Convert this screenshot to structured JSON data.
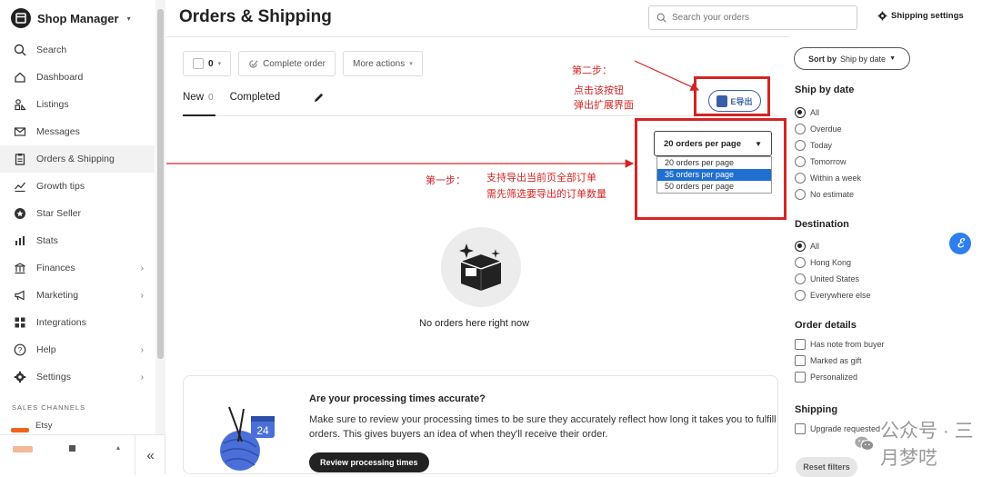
{
  "sidebar": {
    "title": "Shop Manager",
    "items": [
      {
        "label": "Search",
        "icon": "search-icon"
      },
      {
        "label": "Dashboard",
        "icon": "home-icon"
      },
      {
        "label": "Listings",
        "icon": "listings-icon"
      },
      {
        "label": "Messages",
        "icon": "mail-icon"
      },
      {
        "label": "Orders & Shipping",
        "icon": "clipboard-icon"
      },
      {
        "label": "Growth tips",
        "icon": "chart-icon"
      },
      {
        "label": "Star Seller",
        "icon": "star-seller-icon"
      },
      {
        "label": "Stats",
        "icon": "stats-icon"
      },
      {
        "label": "Finances",
        "icon": "bank-icon"
      },
      {
        "label": "Marketing",
        "icon": "megaphone-icon"
      },
      {
        "label": "Integrations",
        "icon": "grid-icon"
      },
      {
        "label": "Help",
        "icon": "help-icon"
      },
      {
        "label": "Settings",
        "icon": "gear-icon"
      }
    ],
    "sales_channels_label": "SALES CHANNELS",
    "etsy_label": "Etsy",
    "collapse_glyph": "«"
  },
  "header": {
    "title": "Orders & Shipping",
    "search_placeholder": "Search your orders",
    "shipping_settings": "Shipping settings"
  },
  "toolbar": {
    "select_count": "0",
    "complete_order": "Complete order",
    "more_actions": "More actions"
  },
  "tabs": {
    "new_label": "New",
    "new_count": "0",
    "completed_label": "Completed"
  },
  "per_page": {
    "selected": "20 orders per page",
    "options": [
      "20 orders per page",
      "35 orders per page",
      "50 orders per page"
    ]
  },
  "export_button": {
    "label": "E导出"
  },
  "annotations": {
    "step2_title": "第二步：",
    "step2_line1": "点击该按钮",
    "step2_line2": "弹出扩展界面",
    "step1_title": "第一步：",
    "step1_line1": "支持导出当前页全部订单",
    "step1_line2": "需先筛选要导出的订单数量",
    "color": "#d32525"
  },
  "empty_state": {
    "text": "No orders here right now"
  },
  "processing_card": {
    "title": "Are your processing times accurate?",
    "body": "Make sure to review your processing times to be sure they accurately reflect how long it takes you to fulfill orders. This gives buyers an idea of when they'll receive their order.",
    "button": "Review processing times",
    "calendar_day": "24"
  },
  "filters": {
    "sort_prefix": "Sort by",
    "sort_value": "Ship by date",
    "ship_by_date": {
      "title": "Ship by date",
      "options": [
        "All",
        "Overdue",
        "Today",
        "Tomorrow",
        "Within a week",
        "No estimate"
      ],
      "selected": "All"
    },
    "destination": {
      "title": "Destination",
      "options": [
        "All",
        "Hong Kong",
        "United States",
        "Everywhere else"
      ],
      "selected": "All"
    },
    "order_details": {
      "title": "Order details",
      "options": [
        "Has note from buyer",
        "Marked as gift",
        "Personalized"
      ]
    },
    "shipping": {
      "title": "Shipping",
      "options": [
        "Upgrade requested"
      ]
    },
    "reset": "Reset filters"
  },
  "watermark": {
    "text": "公众号 · 三月梦呓"
  },
  "colors": {
    "accent": "#222222",
    "etsy_orange": "#f1641e",
    "highlight_blue": "#1f6fd1",
    "annotation_red": "#d32525"
  }
}
